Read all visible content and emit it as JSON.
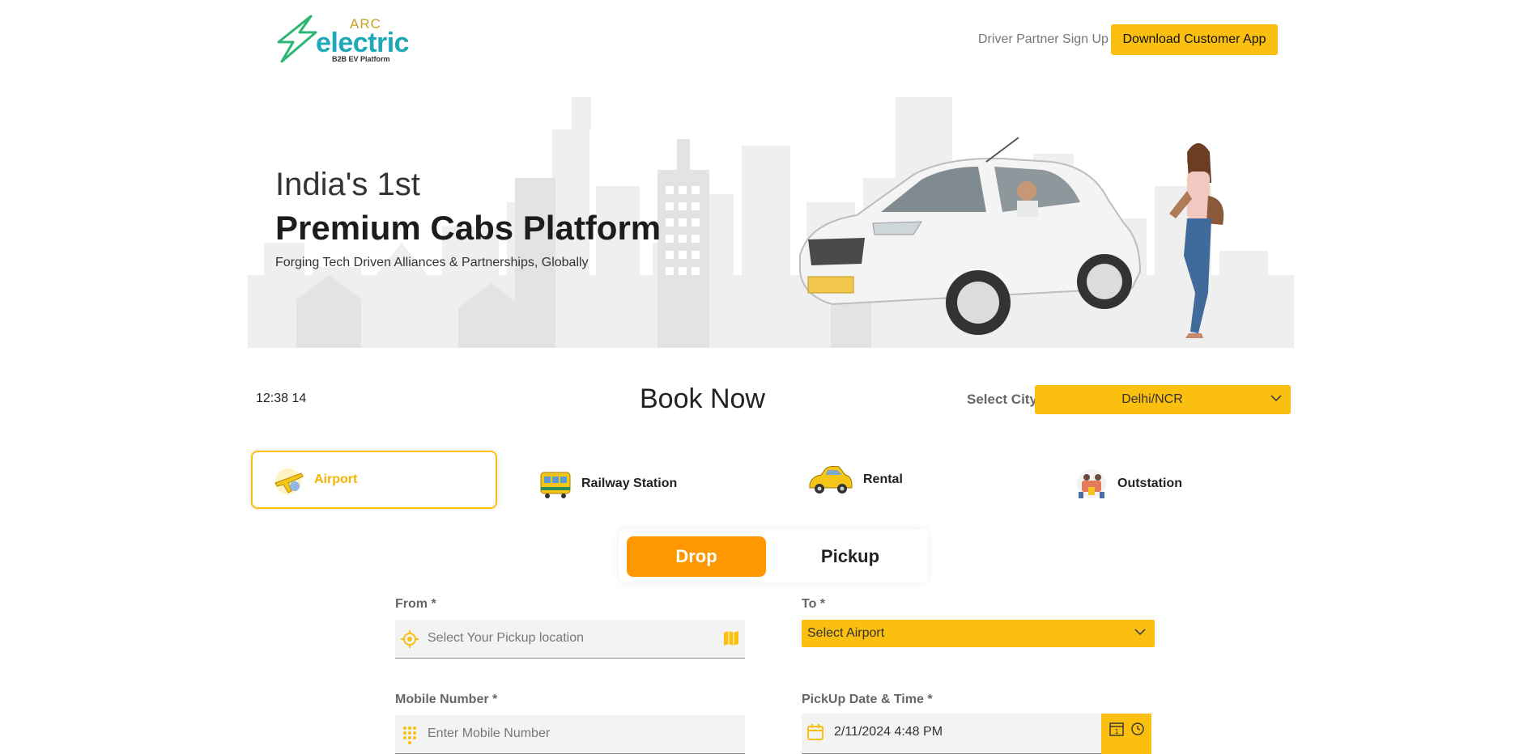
{
  "header": {
    "logo_arc": "ARC",
    "logo_electric": "electric",
    "logo_tagline": "B2B EV Platform",
    "driver_link": "Driver Partner Sign Up",
    "download_button": "Download Customer App"
  },
  "hero": {
    "line1": "India's 1st",
    "title": "Premium Cabs Platform",
    "subtitle": "Forging Tech Driven Alliances & Partnerships, Globally"
  },
  "booking": {
    "clock": "12:38 14",
    "heading": "Book Now",
    "city_label": "Select City",
    "city_value": "Delhi/NCR"
  },
  "categories": [
    {
      "label": "Airport",
      "icon": "airplane-icon",
      "active": true
    },
    {
      "label": "Railway Station",
      "icon": "train-icon",
      "active": false
    },
    {
      "label": "Rental",
      "icon": "taxi-icon",
      "active": false
    },
    {
      "label": "Outstation",
      "icon": "travel-icon",
      "active": false
    }
  ],
  "trip_toggle": {
    "drop": "Drop",
    "pickup": "Pickup",
    "selected": "Drop"
  },
  "form": {
    "from_label": "From *",
    "from_placeholder": "Select Your Pickup location",
    "to_label": "To *",
    "to_value": "Select Airport",
    "mobile_label": "Mobile Number *",
    "mobile_placeholder": "Enter Mobile Number",
    "datetime_label": "PickUp Date & Time *",
    "datetime_value": "2/11/2024 4:48 PM",
    "calendar_day_icon_text": "1"
  },
  "colors": {
    "accent_yellow": "#fbbf0f",
    "drop_orange": "#ff9800",
    "logo_teal": "#1fa8b8",
    "logo_gold": "#c9a227"
  }
}
